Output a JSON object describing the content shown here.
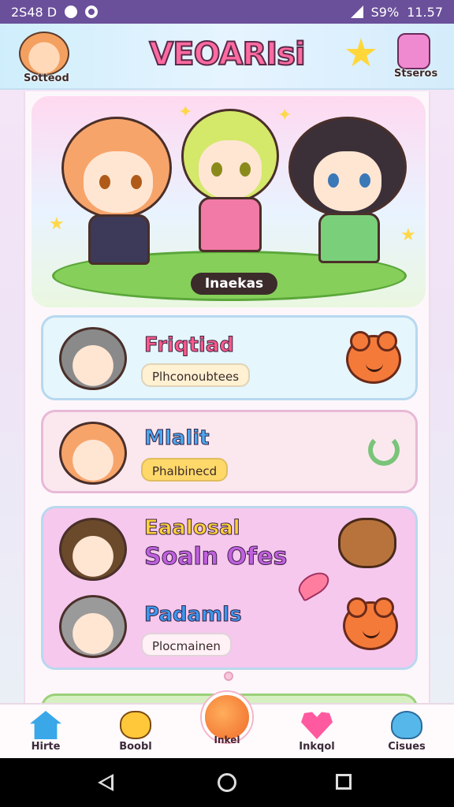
{
  "status_bar": {
    "time_left": "2S48 D",
    "battery": "S9%",
    "clock": "11.57"
  },
  "header": {
    "app_title": "VEOARIsi",
    "left_avatar_label": "Sotteod",
    "right_icon_label": "Stseros",
    "star_icon": "star-icon",
    "right_icon": "pet-icon"
  },
  "hero": {
    "label": "Inaekas"
  },
  "cards": [
    {
      "title": "Friqtiad",
      "chip": "Plhconoubtees",
      "title_color": "#ff5a8a",
      "chip_color": "#fff1d2",
      "bg": "#e6f6fd",
      "accent_icon": "bear-icon"
    },
    {
      "title": "Mlalit",
      "chip": "Phalbinecd",
      "title_color": "#4aa8f0",
      "chip_color": "#ffd86a",
      "bg": "#fbe8ef",
      "accent_icon": "hook-icon"
    },
    {
      "title": "Eaalosal",
      "subtitle": "Soaln Ofes",
      "title_color": "#ffd23a",
      "subtitle_color": "#c060e0",
      "bg": "#f6c8ee",
      "accent_icon": "dog-icon"
    },
    {
      "title": "Padamls",
      "chip": "Plocmainen",
      "title_color": "#3a98f0",
      "chip_color": "#fff1f6",
      "bg": "#f6c8ee",
      "accent_icon": "bear-icon"
    }
  ],
  "bottom_nav": [
    {
      "label": "Hirte",
      "icon": "home-icon"
    },
    {
      "label": "Boobl",
      "icon": "blob-icon"
    },
    {
      "label": "Inkel",
      "icon": "fab-bear-icon"
    },
    {
      "label": "Inkqol",
      "icon": "heart-icon"
    },
    {
      "label": "Cisues",
      "icon": "cloud-icon"
    }
  ]
}
